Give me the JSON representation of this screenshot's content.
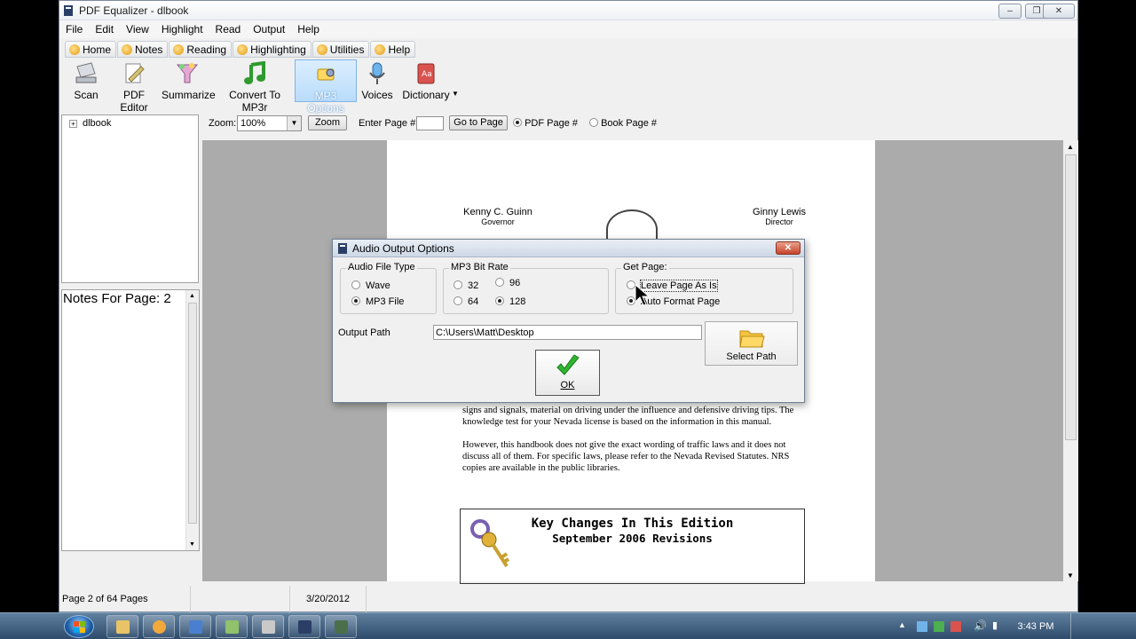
{
  "window": {
    "title": "PDF Equalizer - dlbook"
  },
  "menu": [
    "File",
    "Edit",
    "View",
    "Highlight",
    "Read",
    "Output",
    "Help"
  ],
  "tabs": [
    "Home",
    "Notes",
    "Reading",
    "Highlighting",
    "Utilities",
    "Help"
  ],
  "toolbar": [
    "Scan",
    "PDF Editor",
    "Summarize",
    "Convert To MP3r",
    "MP3 Options",
    "Voices",
    "Dictionary"
  ],
  "tree": {
    "root": "dlbook"
  },
  "notes": {
    "label": "Notes For Page: 2"
  },
  "viewbar": {
    "zoom_label": "Zoom:",
    "zoom_value": "100%",
    "zoom_button": "Zoom",
    "page_label": "Enter Page #:",
    "page_value": "",
    "goto_button": "Go to Page",
    "pdf_page": "PDF Page #",
    "book_page": "Book Page #"
  },
  "document": {
    "left_name": "Kenny C. Guinn",
    "left_title": "Governor",
    "right_name": "Ginny Lewis",
    "right_title": "Director",
    "para1": "signs and signals, material on driving under the influence and defensive driving tips. The knowledge test for your Nevada license is based on the information in this manual.",
    "para2": "However, this handbook does not give the exact wording of traffic laws and it does not discuss all of them. For specific laws, please refer to the Nevada Revised Statutes. NRS copies are available in the public libraries.",
    "box_title": "Key Changes In This Edition",
    "box_subtitle": "September 2006 Revisions"
  },
  "status": {
    "pages": "Page 2 of 64 Pages",
    "date": "3/20/2012"
  },
  "dialog": {
    "title": "Audio Output Options",
    "file_type": {
      "label": "Audio File Type",
      "options": [
        "Wave",
        "MP3 File"
      ],
      "selected": "MP3 File"
    },
    "bitrate": {
      "label": "MP3 Bit Rate",
      "options": [
        "32",
        "96",
        "64",
        "128"
      ],
      "selected": "128"
    },
    "get_page": {
      "label": "Get Page:",
      "options": [
        "Leave Page As Is",
        "Auto Format Page"
      ],
      "selected": "Auto Format Page"
    },
    "output_path_label": "Output Path",
    "output_path": "C:\\Users\\Matt\\Desktop",
    "select_path": "Select Path",
    "ok": "OK"
  },
  "taskbar": {
    "time": "3:43 PM"
  }
}
